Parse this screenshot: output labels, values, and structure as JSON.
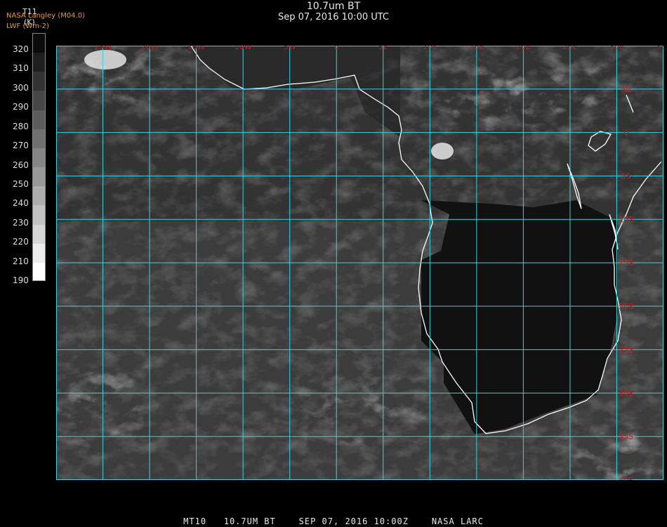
{
  "title": "10.7um BT",
  "subtitle": "Sep 07, 2016 10:00 UTC",
  "credit_line1": "NASA Langley (M04.0)",
  "credit_line2": "LWF (Wm-2)",
  "colorbar": {
    "variable": "T11",
    "unit": "(K)",
    "ticks": [
      "320",
      "310",
      "300",
      "290",
      "280",
      "270",
      "260",
      "250",
      "240",
      "230",
      "220",
      "210",
      "190"
    ],
    "range_k": [
      190,
      320
    ]
  },
  "map": {
    "lon_labels": [
      "25W",
      "20W",
      "15W",
      "10W",
      "5W",
      "0",
      "5E",
      "10E",
      "15E",
      "20E",
      "25E",
      "30E",
      "35E"
    ],
    "lat_labels": [
      "5N",
      "0",
      "5S",
      "10S",
      "15S",
      "20S",
      "25S",
      "30S",
      "35S",
      "40S"
    ],
    "lon_range": [
      -30,
      35
    ],
    "lat_range": [
      -40,
      10
    ],
    "grid_color": "#31d6de",
    "label_color": "#d01818",
    "coast_color": "#ffffff"
  },
  "footer": "MT10   10.7UM BT    SEP 07, 2016 10:00Z    NASA LARC"
}
